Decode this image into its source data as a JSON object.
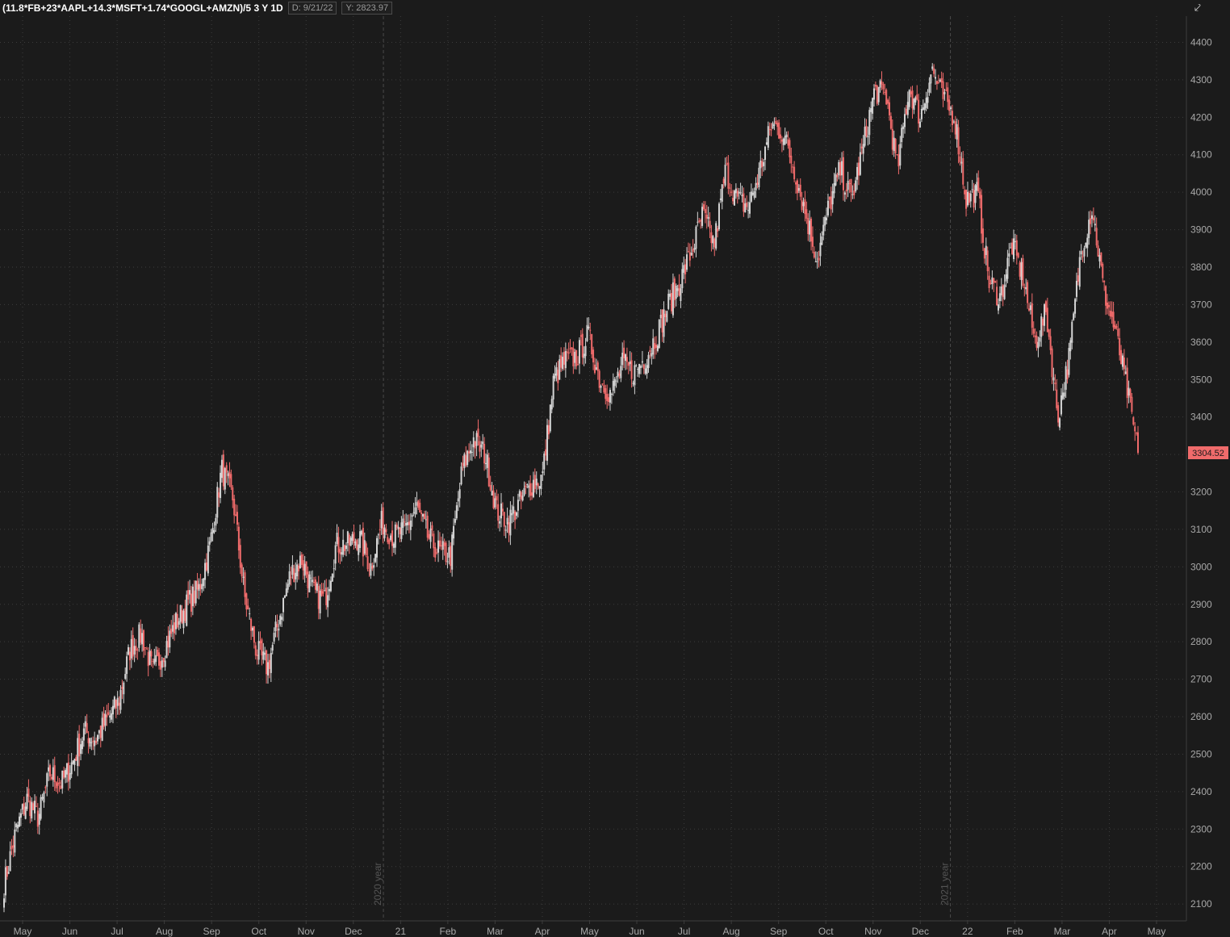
{
  "header": {
    "symbol": "(11.8*FB+23*AAPL+14.3*MSFT+1.74*GOOGL+AMZN)/5 3 Y 1D",
    "date_readout": "D: 9/21/22",
    "value_readout": "Y: 2823.97",
    "icon": "collapse-icon"
  },
  "colors": {
    "background": "#1b1b1b",
    "grid": "#3c3c3c",
    "up": "#d4d4d4",
    "down": "#f06b6b",
    "axis_text": "#a8a8a8",
    "price_badge": "#f06b6b"
  },
  "chart_data": {
    "type": "candlestick",
    "title": "",
    "xlabel": "",
    "ylabel": "",
    "ylim": [
      2055,
      4470
    ],
    "y_ticks": [
      2100,
      2200,
      2300,
      2400,
      2500,
      2600,
      2700,
      2800,
      2900,
      3000,
      3100,
      3200,
      3300,
      3400,
      3500,
      3600,
      3700,
      3800,
      3900,
      4000,
      4100,
      4200,
      4300,
      4400
    ],
    "x_tick_labels": [
      "May",
      "Jun",
      "Jul",
      "Aug",
      "Sep",
      "Oct",
      "Nov",
      "Dec",
      "21",
      "Feb",
      "Mar",
      "Apr",
      "May",
      "Jun",
      "Jul",
      "Aug",
      "Sep",
      "Oct",
      "Nov",
      "Dec",
      "22",
      "Feb",
      "Mar",
      "Apr",
      "May"
    ],
    "year_markers": [
      {
        "label": "2020 year",
        "after_tick": "Dec"
      },
      {
        "label": "2021 year",
        "after_tick": "Dec"
      }
    ],
    "last_price": 3304.52,
    "grid": true,
    "closes": [
      2150,
      2290,
      2380,
      2330,
      2450,
      2420,
      2480,
      2560,
      2540,
      2590,
      2640,
      2780,
      2820,
      2720,
      2780,
      2850,
      2900,
      2940,
      3060,
      3260,
      3180,
      2920,
      2780,
      2730,
      2860,
      2980,
      3020,
      2930,
      2910,
      3060,
      3060,
      3080,
      3000,
      3120,
      3080,
      3100,
      3160,
      3080,
      3040,
      3030,
      3260,
      3340,
      3300,
      3150,
      3120,
      3170,
      3220,
      3240,
      3500,
      3550,
      3560,
      3620,
      3500,
      3460,
      3540,
      3520,
      3560,
      3620,
      3700,
      3760,
      3840,
      3940,
      3860,
      4060,
      3980,
      3960,
      4060,
      4180,
      4160,
      4060,
      3940,
      3820,
      3960,
      4060,
      3980,
      4120,
      4270,
      4260,
      4060,
      4280,
      4200,
      4330,
      4250,
      4200,
      3980,
      4000,
      3760,
      3720,
      3860,
      3770,
      3600,
      3680,
      3400,
      3560,
      3840,
      3960,
      3740,
      3630,
      3480,
      3304.52
    ]
  }
}
